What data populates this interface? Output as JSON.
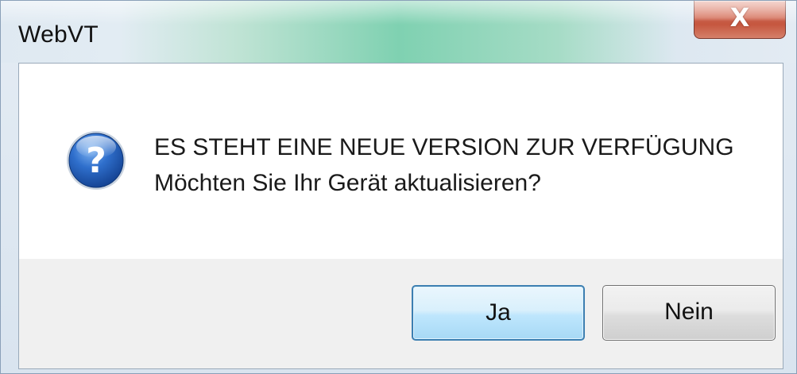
{
  "window": {
    "title": "WebVT",
    "close_glyph": "X"
  },
  "message": {
    "icon": "question-icon",
    "line1": "ES STEHT EINE NEUE VERSION ZUR VERFÜGUNG",
    "line2": "Möchten Sie Ihr Gerät aktualisieren?"
  },
  "buttons": {
    "yes_label": "Ja",
    "no_label": "Nein"
  },
  "colors": {
    "icon_blue": "#1f5fb8",
    "default_button_border": "#3c7fb1",
    "close_red": "#c24d35"
  }
}
